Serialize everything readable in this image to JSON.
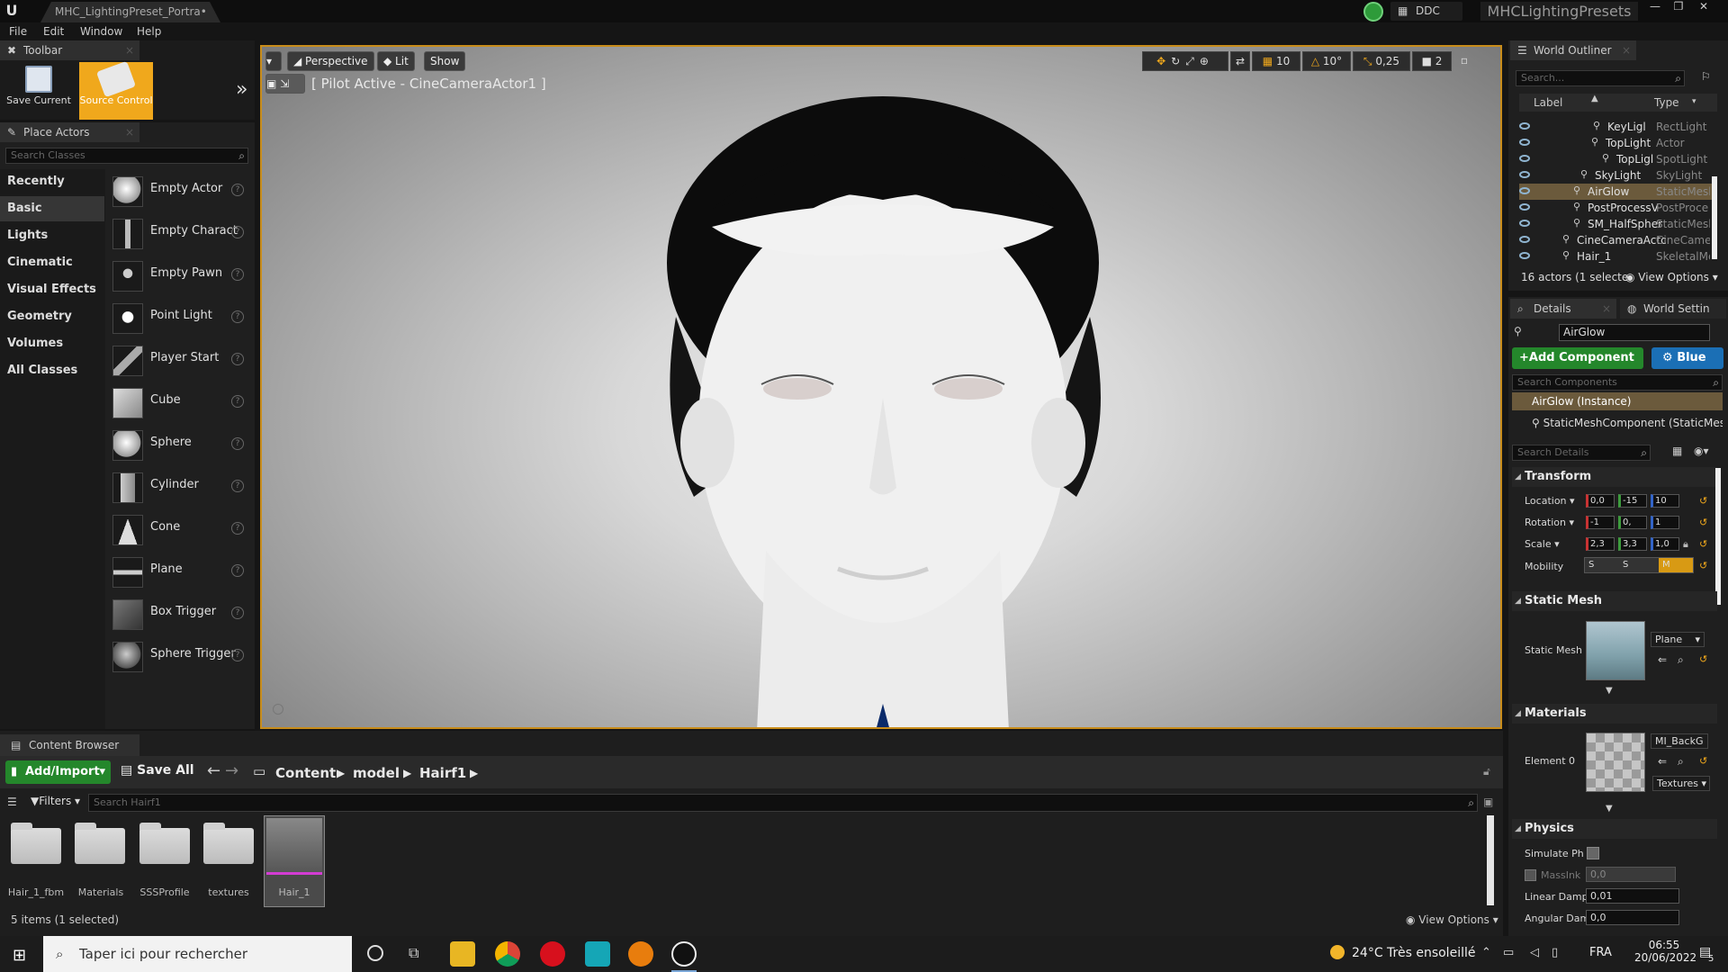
{
  "titlebar": {
    "doc_tab": "MHC_LightingPreset_Portra•",
    "ddc": "DDC",
    "project": "MHCLightingPresets",
    "minimize": "—",
    "maximize": "❐",
    "close": "✕"
  },
  "menu": {
    "file": "File",
    "edit": "Edit",
    "window": "Window",
    "help": "Help"
  },
  "toolbar": {
    "tab": "Toolbar",
    "save_current": "Save Current",
    "source_control": "Source Control",
    "expand": "»"
  },
  "place_actors": {
    "tab": "Place Actors",
    "search_placeholder": "Search Classes",
    "categories": [
      "Recently Placed",
      "Basic",
      "Lights",
      "Cinematic",
      "Visual Effects",
      "Geometry",
      "Volumes",
      "All Classes"
    ],
    "selected_category": "Basic",
    "actors": [
      "Empty Actor",
      "Empty Charact",
      "Empty Pawn",
      "Point Light",
      "Player Start",
      "Cube",
      "Sphere",
      "Cylinder",
      "Cone",
      "Plane",
      "Box Trigger",
      "Sphere Trigger"
    ]
  },
  "viewport": {
    "perspective": "Perspective",
    "lit": "Lit",
    "show": "Show",
    "pilot": "[ Pilot Active - CineCameraActor1 ]",
    "grid": "10",
    "angle": "10°",
    "scale": "0,25",
    "camera_speed": "2"
  },
  "content_browser": {
    "tab": "Content Browser",
    "add_import": "Add/Import",
    "save_all": "Save All",
    "path": [
      "Content",
      "model",
      "Hairf1"
    ],
    "search_placeholder": "Search Hairf1",
    "filters": "Filters",
    "assets": [
      "Hair_1_fbm",
      "Materials",
      "SSSProfile",
      "textures",
      "Hair_1"
    ],
    "status": "5 items (1 selected)",
    "view_options": "View Options"
  },
  "outliner": {
    "tab": "World Outliner",
    "search_placeholder": "Search...",
    "col_label": "Label",
    "col_type": "Type",
    "rows": [
      {
        "label": "KeyLigl",
        "type": "RectLight"
      },
      {
        "label": "TopLight",
        "type": "Actor"
      },
      {
        "label": "TopLigl",
        "type": "SpotLight"
      },
      {
        "label": "SkyLight",
        "type": "SkyLight"
      },
      {
        "label": "AirGlow",
        "type": "StaticMesh"
      },
      {
        "label": "PostProcessV",
        "type": "PostProce"
      },
      {
        "label": "SM_HalfSpher",
        "type": "StaticMesl"
      },
      {
        "label": "CineCameraActc",
        "type": "CineCame"
      },
      {
        "label": "Hair_1",
        "type": "SkeletalMe"
      }
    ],
    "status": "16 actors (1 selecte",
    "view_options": "View Options"
  },
  "details": {
    "tab": "Details",
    "world_settings": "World Settin",
    "name": "AirGlow",
    "add_component": "Add Component",
    "blueprint": "Blue",
    "search_components": "Search Components",
    "instance": "AirGlow (Instance)",
    "component": "StaticMeshComponent (StaticMeshC",
    "search_details": "Search Details",
    "transform": {
      "title": "Transform",
      "location_label": "Location",
      "rotation_label": "Rotation",
      "scale_label": "Scale",
      "mobility_label": "Mobility",
      "location": [
        "0,0",
        "-15",
        "10"
      ],
      "rotation": [
        "-1",
        "0,",
        "1"
      ],
      "scale": [
        "2,3",
        "3,3",
        "1,0"
      ],
      "mobility": [
        "S",
        "S",
        "M"
      ]
    },
    "static_mesh": {
      "title": "Static Mesh",
      "label": "Static Mesh",
      "value": "Plane"
    },
    "materials": {
      "title": "Materials",
      "label": "Element 0",
      "value": "MI_BackG",
      "textures": "Textures"
    },
    "physics": {
      "title": "Physics",
      "simulate": "Simulate Ph",
      "mass": "MassInk",
      "mass_value": "0,0",
      "linear_label": "Linear Damp",
      "linear_value": "0,01",
      "angular_label": "Angular Dam",
      "angular_value": "0,0"
    }
  },
  "taskbar": {
    "search": "Taper ici pour rechercher",
    "weather": "24°C  Très ensoleillé",
    "lang": "FRA",
    "time": "06:55",
    "date": "20/06/2022",
    "notif": "5"
  },
  "colors": {
    "accent_orange": "#c88c1a",
    "add_green": "#24872b",
    "blue_btn": "#1b6fb5",
    "selected_row": "#6b5a3c"
  }
}
